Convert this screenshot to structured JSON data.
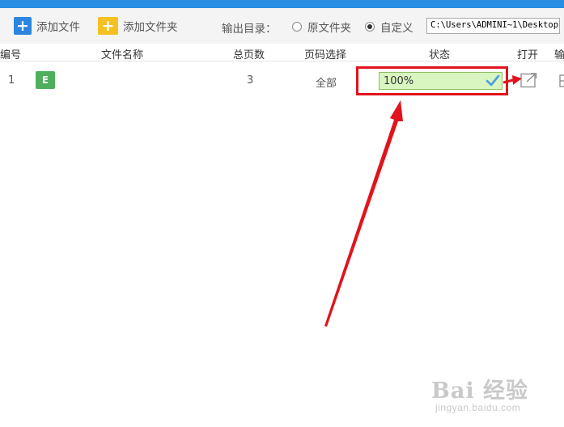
{
  "toolbar": {
    "add_file_label": "添加文件",
    "add_folder_label": "添加文件夹",
    "output_dir_label": "输出目录：",
    "radio_original_label": "原文件夹",
    "radio_custom_label": "自定义",
    "selected_radio": "custom",
    "output_path": "C:\\Users\\ADMINI~1\\Desktop\\"
  },
  "table": {
    "columns": [
      "编号",
      "文件名称",
      "总页数",
      "页码选择",
      "状态",
      "打开",
      "输"
    ],
    "rows": [
      {
        "index": "1",
        "file_type_badge": "E",
        "file_name": "",
        "total_pages": "3",
        "page_selection": "全部",
        "status_progress_text": "100%",
        "progress_fraction": 1.0
      }
    ]
  },
  "watermark": {
    "logo": "Bai 经验",
    "url": "jingyan.baidu.com"
  },
  "colors": {
    "titlebar": "#2a8fe3",
    "add_file_icon": "#2c86e0",
    "add_folder_icon": "#f5c021",
    "file_badge": "#4fae5c",
    "progress_bg": "#d9f5c0",
    "check": "#4b9ce0",
    "annotation_red": "#e0141d"
  },
  "icons": {
    "add_file": "plus-icon",
    "add_folder": "plus-folder-icon",
    "status_done": "check-icon",
    "open": "open-external-icon"
  }
}
